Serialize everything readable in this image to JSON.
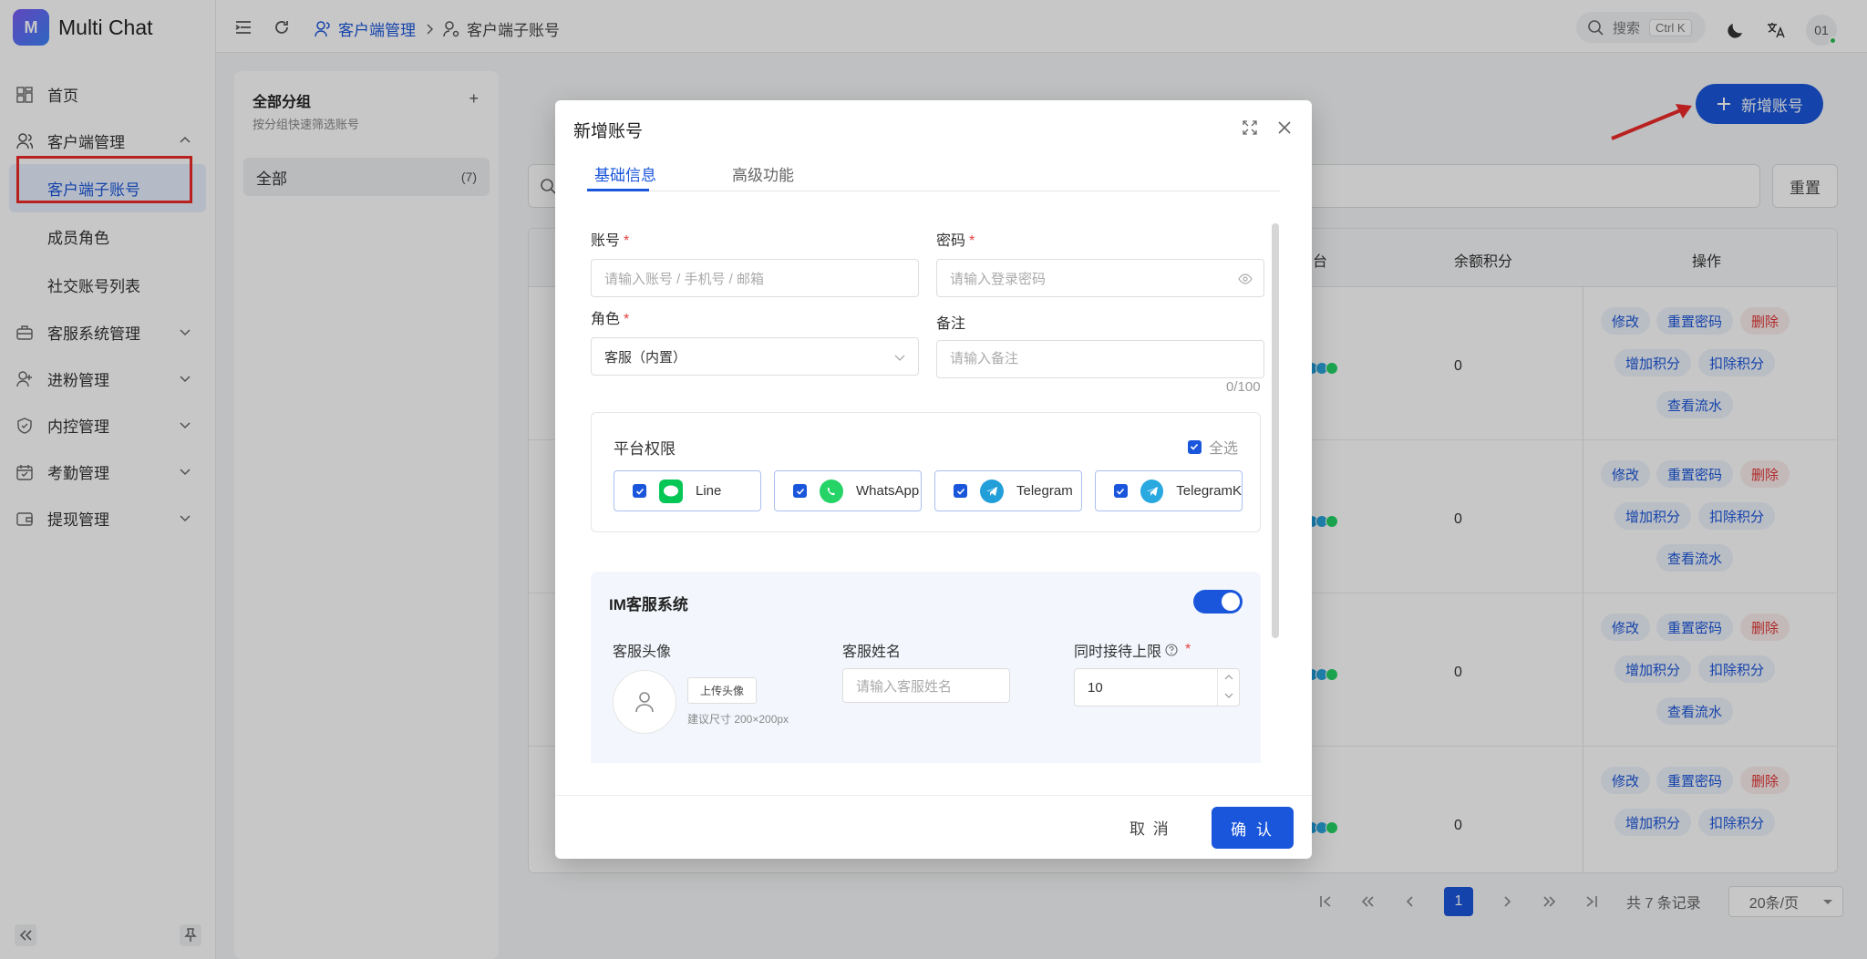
{
  "app": {
    "name": "Multi Chat",
    "logo_letter": "M"
  },
  "sidebar": {
    "items": [
      {
        "label": "首页",
        "icon": "dashboard-icon"
      },
      {
        "label": "客户端管理",
        "icon": "users-icon"
      },
      {
        "label": "客户端子账号",
        "sub": true,
        "active": true
      },
      {
        "label": "成员角色",
        "sub": true
      },
      {
        "label": "社交账号列表",
        "sub": true
      },
      {
        "label": "客服系统管理",
        "icon": "briefcase-icon"
      },
      {
        "label": "进粉管理",
        "icon": "user-plus-icon"
      },
      {
        "label": "内控管理",
        "icon": "shield-icon"
      },
      {
        "label": "考勤管理",
        "icon": "calendar-icon"
      },
      {
        "label": "提现管理",
        "icon": "wallet-icon"
      }
    ]
  },
  "topbar": {
    "breadcrumb": [
      "客户端管理",
      "客户端子账号"
    ],
    "search_label": "搜索",
    "search_shortcut": "Ctrl K",
    "avatar_text": "01"
  },
  "groups": {
    "title": "全部分组",
    "subtitle": "按分组快速筛选账号",
    "add_symbol": "+",
    "all_label": "全部",
    "all_count": "(7)"
  },
  "page": {
    "add_account_label": "新增账号",
    "reset_label": "重置",
    "table_headers": {
      "platform": "台",
      "points": "余额积分",
      "ops": "操作"
    },
    "rows": [
      {
        "points": "0"
      },
      {
        "points": "0"
      },
      {
        "points": "0"
      },
      {
        "points": "0"
      }
    ],
    "ops_labels": {
      "edit": "修改",
      "reset_pwd": "重置密码",
      "delete": "删除",
      "add_points": "增加积分",
      "deduct_points": "扣除积分",
      "view_flow": "查看流水"
    },
    "pager": {
      "current": "1",
      "total": "共 7 条记录",
      "page_size": "20条/页"
    }
  },
  "modal": {
    "title": "新增账号",
    "tabs": [
      "基础信息",
      "高级功能"
    ],
    "account_label": "账号",
    "account_placeholder": "请输入账号 / 手机号 / 邮箱",
    "password_label": "密码",
    "password_placeholder": "请输入登录密码",
    "role_label": "角色",
    "role_value": "客服（内置）",
    "remark_label": "备注",
    "remark_placeholder": "请输入备注",
    "remark_counter": "0/100",
    "platform_title": "平台权限",
    "select_all": "全选",
    "platforms": [
      {
        "name": "Line",
        "color": "#06c755"
      },
      {
        "name": "WhatsApp",
        "color": "#25d366"
      },
      {
        "name": "Telegram",
        "color": "#229ed9"
      },
      {
        "name": "TelegramK",
        "color": "#2aa8e0"
      }
    ],
    "im_title": "IM客服系统",
    "avatar_label": "客服头像",
    "upload_label": "上传头像",
    "upload_tip": "建议尺寸 200×200px",
    "cs_name_label": "客服姓名",
    "cs_name_placeholder": "请输入客服姓名",
    "concurrent_label": "同时接待上限",
    "concurrent_value": "10",
    "cancel_label": "取 消",
    "confirm_label": "确 认"
  },
  "colors": {
    "primary": "#1a56db",
    "danger": "#e53e3e",
    "highlight": "#ee2a2a"
  }
}
